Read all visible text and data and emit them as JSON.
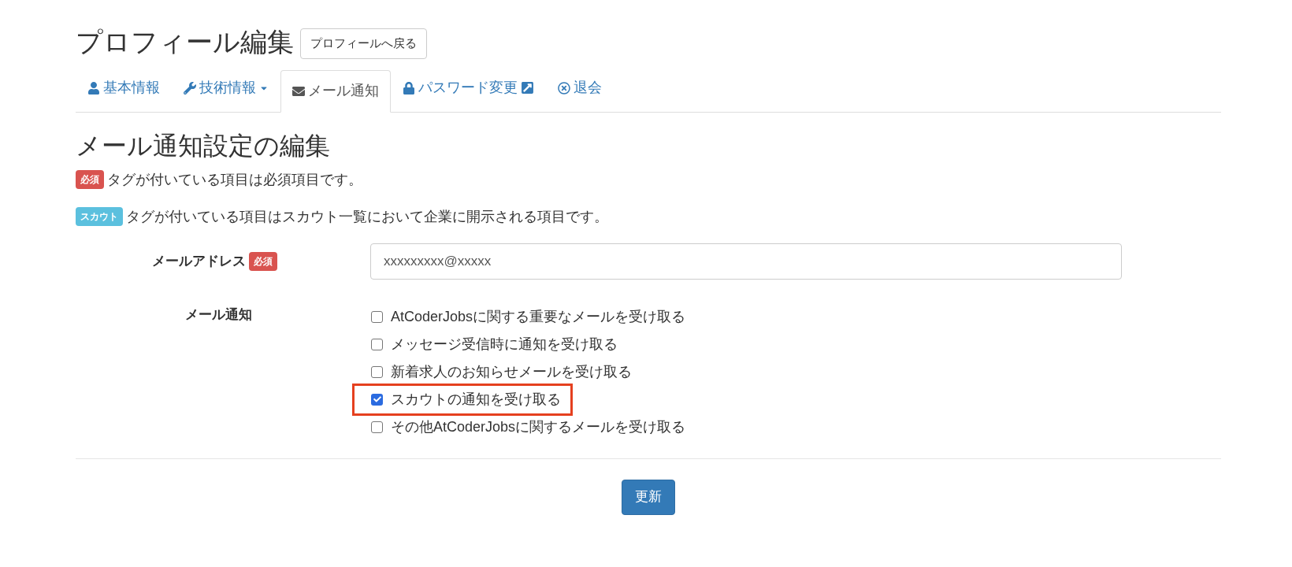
{
  "page_title": "プロフィール編集",
  "back_button": "プロフィールへ戻る",
  "tabs": [
    {
      "label": "基本情報",
      "kind": "user",
      "selected": false,
      "dropdown": false,
      "external": false
    },
    {
      "label": "技術情報",
      "kind": "wrench",
      "selected": false,
      "dropdown": true,
      "external": false
    },
    {
      "label": "メール通知",
      "kind": "envelope",
      "selected": true,
      "dropdown": false,
      "external": false
    },
    {
      "label": "パスワード変更",
      "kind": "lock",
      "selected": false,
      "dropdown": false,
      "external": true
    },
    {
      "label": "退会",
      "kind": "cancel",
      "selected": false,
      "dropdown": false,
      "external": false
    }
  ],
  "heading": "メール通知設定の編集",
  "legend": [
    {
      "tag": "必須",
      "kind": "required",
      "text": "タグが付いている項目は必須項目です。"
    },
    {
      "tag": "スカウト",
      "kind": "scout",
      "text": "タグが付いている項目はスカウト一覧において企業に開示される項目です。"
    }
  ],
  "email": {
    "label": "メールアドレス",
    "tag": "必須",
    "value": "xxxxxxxxx@xxxxx"
  },
  "notifications": {
    "label": "メール通知",
    "options": [
      {
        "label": "AtCoderJobsに関する重要なメールを受け取る",
        "checked": false,
        "highlighted": false
      },
      {
        "label": "メッセージ受信時に通知を受け取る",
        "checked": false,
        "highlighted": false
      },
      {
        "label": "新着求人のお知らせメールを受け取る",
        "checked": false,
        "highlighted": false
      },
      {
        "label": "スカウトの通知を受け取る",
        "checked": true,
        "highlighted": true
      },
      {
        "label": "その他AtCoderJobsに関するメールを受け取る",
        "checked": false,
        "highlighted": false
      }
    ]
  },
  "submit_button": "更新"
}
